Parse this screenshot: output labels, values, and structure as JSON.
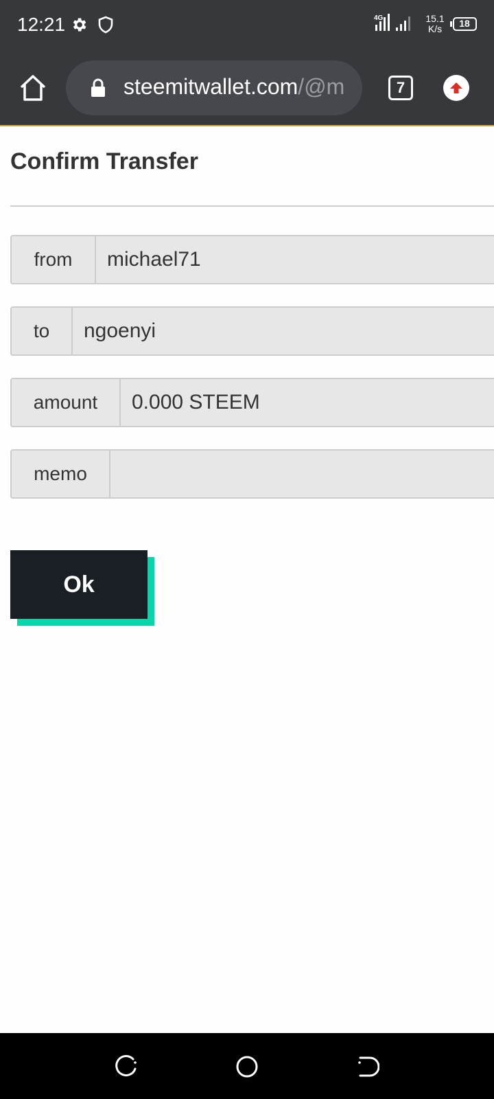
{
  "status_bar": {
    "time": "12:21",
    "network_type": "4G",
    "speed_value": "15.1",
    "speed_unit": "K/s",
    "battery": "18"
  },
  "browser": {
    "url_domain": "steemitwallet.com",
    "url_path": "/@m",
    "tab_count": "7",
    "accent_color": "#d7a443"
  },
  "page": {
    "title": "Confirm Transfer",
    "fields": [
      {
        "label": "from",
        "value": "michael71"
      },
      {
        "label": "to",
        "value": "ngoenyi"
      },
      {
        "label": "amount",
        "value": "0.000 STEEM"
      },
      {
        "label": "memo",
        "value": ""
      }
    ],
    "ok_label": "Ok",
    "ok_color": "#1a1f26",
    "ok_shadow_color": "#06d6a9"
  },
  "icons": {
    "status": [
      "gear-icon",
      "shield-icon",
      "signal-icon",
      "battery-icon"
    ],
    "toolbar": [
      "home-icon",
      "lock-icon",
      "tabs-icon",
      "update-icon"
    ],
    "nav": [
      "recent-apps-icon",
      "home-circle-icon",
      "back-icon"
    ]
  }
}
